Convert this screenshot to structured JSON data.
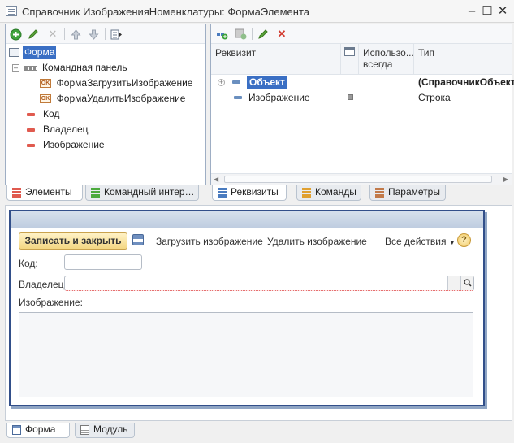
{
  "window": {
    "title": "Справочник ИзображенияНоменклатуры: ФормаЭлемента",
    "minimize_icon": "minimize-icon",
    "maximize_icon": "maximize-icon",
    "close_icon": "close-icon"
  },
  "elements_tree": {
    "items": [
      {
        "label": "Форма",
        "level": 0,
        "selected": true
      },
      {
        "label": "Командная панель",
        "level": 1,
        "expanded": true
      },
      {
        "label": "ФормаЗагрузитьИзображение",
        "level": 2
      },
      {
        "label": "ФормаУдалитьИзображение",
        "level": 2
      },
      {
        "label": "Код",
        "level": 1
      },
      {
        "label": "Владелец",
        "level": 1
      },
      {
        "label": "Изображение",
        "level": 1
      }
    ]
  },
  "left_tabs": [
    {
      "label": "Элементы",
      "active": true
    },
    {
      "label": "Командный интер…",
      "active": false
    }
  ],
  "attributes_grid": {
    "headers": {
      "col1": "Реквизит",
      "col3": "Использо... всегда",
      "col4": "Тип"
    },
    "rows": [
      {
        "name": "Объект",
        "always": "",
        "type": "(СправочникОбъект.",
        "selected": true
      },
      {
        "name": "Изображение",
        "always": "",
        "type": "Строка"
      }
    ]
  },
  "right_tabs": [
    {
      "label": "Реквизиты",
      "active": true
    },
    {
      "label": "Команды",
      "active": false
    },
    {
      "label": "Параметры",
      "active": false
    }
  ],
  "preview": {
    "commandbar": {
      "save_close": "Записать и закрыть",
      "load_image": "Загрузить изображение",
      "delete_image": "Удалить изображение",
      "all_actions": "Все действия",
      "help": "?"
    },
    "fields": {
      "code_label": "Код:",
      "code_value": "",
      "owner_label": "Владелец:",
      "owner_value": "",
      "owner_select": "...",
      "image_label": "Изображение:"
    }
  },
  "bottom_tabs": [
    {
      "label": "Форма",
      "active": true
    },
    {
      "label": "Модуль",
      "active": false
    }
  ]
}
